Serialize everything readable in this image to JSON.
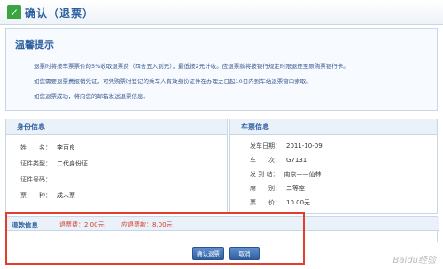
{
  "header": {
    "title": "确认（退票）"
  },
  "tips": {
    "title": "温馨提示",
    "lines": [
      "退票时将按车票票价的5%收取退票费（四舍五入到元），最低按2元计收。应退票款将按银行规定时限退还至原购票银行卡。",
      "如您需要退票费报销凭证，可凭购票时登记的乘车人有效身份证件在办理之日起10日内到车站退票窗口索取。",
      "如您退票成功，将向您的邮箱发送退票信息。"
    ]
  },
  "identity": {
    "heading": "身份信息",
    "rows": [
      {
        "label": "姓　　名：",
        "value": "李百良"
      },
      {
        "label": "证件类型：",
        "value": "二代身份证"
      },
      {
        "label": "证件号码：",
        "value": ""
      },
      {
        "label": "票　　种：",
        "value": "成人票"
      }
    ]
  },
  "ticket": {
    "heading": "车票信息",
    "rows": [
      {
        "label": "发车日期：",
        "value": "2011-10-09"
      },
      {
        "label": "车　　次：",
        "value": "G7131"
      },
      {
        "label": "发 到 站：",
        "value": "南京——仙林"
      },
      {
        "label": "席　　别：",
        "value": "二等座"
      },
      {
        "label": "票　　价：",
        "value": "10.00元"
      }
    ]
  },
  "refund": {
    "label": "退款信息",
    "fee": "退票费：2.00元",
    "amount": "应退票款：8.00元"
  },
  "buttons": {
    "confirm": "确认退票",
    "cancel": "取消"
  },
  "watermark": "Baidu经验",
  "colors": {
    "accent": "#2c5fa0",
    "highlight": "#e23d2f",
    "fee_text": "#d23b2b"
  },
  "icons": {
    "header": "check-icon"
  }
}
